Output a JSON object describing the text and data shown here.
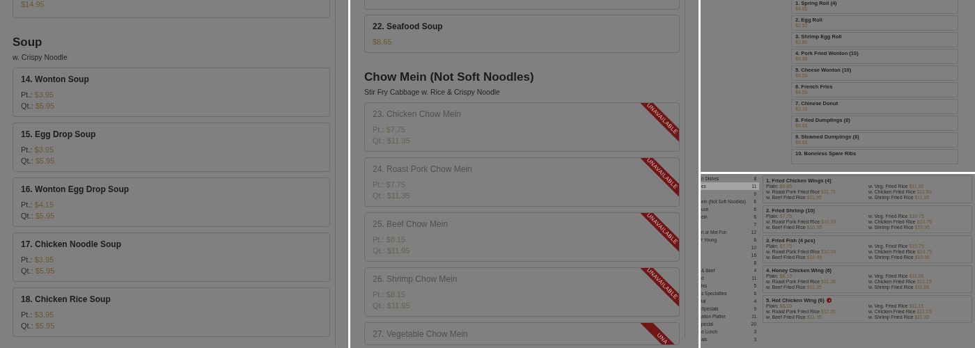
{
  "left_screen": {
    "blocks": [
      {
        "kind": "cut_card",
        "prices": [
          {
            "amount": "$14.95"
          }
        ]
      },
      {
        "kind": "heading",
        "title": "Soup",
        "subtitle": "w. Crispy Noodle"
      },
      {
        "kind": "card",
        "name": "14. Wonton Soup",
        "available": true,
        "prices": [
          {
            "label": "Pt.:",
            "amount": "$3.95"
          },
          {
            "label": "Qt.:",
            "amount": "$5.95"
          }
        ]
      },
      {
        "kind": "card",
        "name": "15. Egg Drop Soup",
        "available": true,
        "prices": [
          {
            "label": "Pt.:",
            "amount": "$3.95"
          },
          {
            "label": "Qt.:",
            "amount": "$5.95"
          }
        ]
      },
      {
        "kind": "card",
        "name": "16. Wonton Egg Drop Soup",
        "available": true,
        "prices": [
          {
            "label": "Pt.:",
            "amount": "$4.15"
          },
          {
            "label": "Qt.:",
            "amount": "$5.95"
          }
        ]
      },
      {
        "kind": "card",
        "name": "17. Chicken Noodle Soup",
        "available": true,
        "prices": [
          {
            "label": "Pt.:",
            "amount": "$3.95"
          },
          {
            "label": "Qt.:",
            "amount": "$5.95"
          }
        ]
      },
      {
        "kind": "card",
        "name": "18. Chicken Rice Soup",
        "available": true,
        "prices": [
          {
            "label": "Pt.:",
            "amount": "$3.95"
          },
          {
            "label": "Qt.:",
            "amount": "$5.95"
          }
        ]
      }
    ]
  },
  "middle_screen": {
    "blocks": [
      {
        "kind": "cut_card"
      },
      {
        "kind": "card",
        "name": "22. Seafood Soup",
        "available": true,
        "prices": [
          {
            "amount": "$8.65"
          }
        ]
      },
      {
        "kind": "heading",
        "title": "Chow Mein (Not Soft Noodles)",
        "subtitle": "Stir Fry Cabbage w. Rice & Crispy Noodle"
      },
      {
        "kind": "card",
        "name": "23. Chicken Chow Mein",
        "available": false,
        "ribbon": "UNAVAILABLE",
        "prices": [
          {
            "label": "Pt.:",
            "amount": "$7.75"
          },
          {
            "label": "Qt.:",
            "amount": "$11.35"
          }
        ]
      },
      {
        "kind": "card",
        "name": "24. Roast Pork Chow Mein",
        "available": false,
        "ribbon": "UNAVAILABLE",
        "prices": [
          {
            "label": "Pt.:",
            "amount": "$7.75"
          },
          {
            "label": "Qt.:",
            "amount": "$11.35"
          }
        ]
      },
      {
        "kind": "card",
        "name": "25. Beef Chow Mein",
        "available": false,
        "ribbon": "UNAVAILABLE",
        "prices": [
          {
            "label": "Pt.:",
            "amount": "$8.15"
          },
          {
            "label": "Qt.:",
            "amount": "$11.95"
          }
        ]
      },
      {
        "kind": "card",
        "name": "26. Shrimp Chow Mein",
        "available": false,
        "ribbon": "UNAVAILABLE",
        "prices": [
          {
            "label": "Pt.:",
            "amount": "$8.15"
          },
          {
            "label": "Qt.:",
            "amount": "$11.95"
          }
        ]
      },
      {
        "kind": "card",
        "name": "27. Vegetable Chow Mein",
        "available": false,
        "ribbon": "UNA"
      }
    ]
  },
  "top_right_screen": {
    "items": [
      {
        "name": "1. Spring Roll (4)",
        "price": "$4.65"
      },
      {
        "name": "2. Egg Roll",
        "price": "$2.50"
      },
      {
        "name": "3. Shrimp Egg Roll",
        "price": "$3.80"
      },
      {
        "name": "4. Pork Fried Wonton (10)",
        "price": "$9.95"
      },
      {
        "name": "5. Cheese Wonton (10)",
        "price": "$8.50"
      },
      {
        "name": "6. French Fries",
        "price": "$4.50"
      },
      {
        "name": "7. Chinese Donut",
        "price": "$3.15"
      },
      {
        "name": "8. Fried Dumplings (8)",
        "price": "$8.65"
      },
      {
        "name": "9. Steamed Dumplings (8)",
        "price": "$8.65"
      },
      {
        "name": "10. Boneless Spare Ribs"
      }
    ]
  },
  "bottom_right_screen": {
    "categories": [
      {
        "name": "n Dishes",
        "count": "8",
        "selected": false
      },
      {
        "name": "es",
        "count": "11",
        "selected": true
      },
      {
        "count": "9",
        "selected": false
      },
      {
        "name": "ein (Not Soft Noodles)",
        "count": "6",
        "selected": false
      },
      {
        "name": "uce",
        "count": "6",
        "selected": false
      },
      {
        "name": "ein",
        "count": "6",
        "selected": false
      },
      {
        "count": "7",
        "selected": false
      },
      {
        "name": "n or Mei Fun",
        "count": "12",
        "selected": false
      },
      {
        "name": "r Young",
        "count": "6",
        "selected": false
      },
      {
        "count": "10",
        "selected": false
      },
      {
        "count": "16",
        "selected": false
      },
      {
        "count": "8",
        "selected": false
      },
      {
        "name": "& Beef",
        "count": "4",
        "selected": false
      },
      {
        "name": "d",
        "count": "11",
        "selected": false
      },
      {
        "name": "les",
        "count": "5",
        "selected": false
      },
      {
        "name": "s Specialties",
        "count": "6",
        "selected": false
      },
      {
        "name": "ial",
        "count": "4",
        "selected": false
      },
      {
        "name": "Specials",
        "count": "9",
        "selected": false
      },
      {
        "name": "ation Platter",
        "count": "11",
        "selected": false
      },
      {
        "name": "pecial",
        "count": "20",
        "selected": false
      },
      {
        "name": "d Lunch",
        "count": "3",
        "selected": false
      },
      {
        "name": "als",
        "count": "3",
        "selected": false
      }
    ],
    "items": [
      {
        "name": "1. Fried Chicken Wings (4)",
        "spicy": false,
        "lines": [
          {
            "label": "Plain:",
            "amount": "$6.95"
          },
          {
            "label": "w. Veg. Fried Rice",
            "amount": "$11.95"
          },
          {
            "label": "w. Roast Pork Fried Rice",
            "amount": "$11.75"
          },
          {
            "label": "w. Chicken Fried Rice",
            "amount": "$11.50"
          },
          {
            "label": "w. Beef Fried Rice",
            "amount": "$11.95"
          },
          {
            "label": "w. Shrimp Fried Rice",
            "amount": "$11.95"
          }
        ]
      },
      {
        "name": "2. Fried Shrimp (10)",
        "spicy": false,
        "lines": [
          {
            "label": "Plain:",
            "amount": "$7.75"
          },
          {
            "label": "w. Veg. Fried Rice",
            "amount": "$10.75"
          },
          {
            "label": "w. Roast Pork Fried Rice",
            "amount": "$10.95"
          },
          {
            "label": "w. Chicken Fried Rice",
            "amount": "$10.75"
          },
          {
            "label": "w. Beef Fried Rice",
            "amount": "$10.95"
          },
          {
            "label": "w. Shrimp Fried Rice",
            "amount": "$10.95"
          }
        ]
      },
      {
        "name": "3. Fried Fish (4 pcs)",
        "spicy": false,
        "lines": [
          {
            "label": "Plain:",
            "amount": "$7.75"
          },
          {
            "label": "w. Veg. Fried Rice",
            "amount": "$10.75"
          },
          {
            "label": "w. Roast Pork Fried Rice",
            "amount": "$10.95"
          },
          {
            "label": "w. Chicken Fried Rice",
            "amount": "$10.75"
          },
          {
            "label": "w. Beef Fried Rice",
            "amount": "$10.95"
          },
          {
            "label": "w. Shrimp Fried Rice",
            "amount": "$10.95"
          }
        ]
      },
      {
        "name": "4. Honey Chicken Wing (6)",
        "spicy": false,
        "lines": [
          {
            "label": "Plain:",
            "amount": "$8.15"
          },
          {
            "label": "w. Veg. Fried Rice",
            "amount": "$11.55"
          },
          {
            "label": "w. Roast Pork Fried Rice",
            "amount": "$11.35"
          },
          {
            "label": "w. Chicken Fried Rice",
            "amount": "$11.15"
          },
          {
            "label": "w. Beef Fried Rice",
            "amount": "$11.35"
          },
          {
            "label": "w. Shrimp Fried Rice",
            "amount": "$11.85"
          }
        ]
      },
      {
        "name": "5. Hot Chicken Wing (6)",
        "spicy": true,
        "lines": [
          {
            "label": "Plain:",
            "amount": "$8.15"
          },
          {
            "label": "w. Veg. Fried Rice",
            "amount": "$11.15"
          },
          {
            "label": "w. Roast Pork Fried Rice",
            "amount": "$11.35"
          },
          {
            "label": "w. Chicken Fried Rice",
            "amount": "$11.15"
          },
          {
            "label": "w. Beef Fried Rice",
            "amount": "$11.35"
          },
          {
            "label": "w. Shrimp Fried Rice",
            "amount": "$11.35"
          }
        ]
      }
    ]
  }
}
